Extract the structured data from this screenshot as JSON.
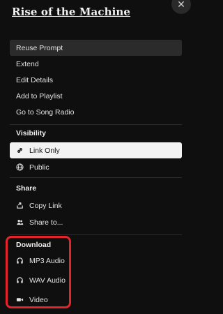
{
  "title": "Rise of the Machine",
  "close_icon": "close-icon",
  "actions": [
    {
      "label": "Reuse Prompt"
    },
    {
      "label": "Extend"
    },
    {
      "label": "Edit Details"
    },
    {
      "label": "Add to Playlist"
    },
    {
      "label": "Go to Song Radio"
    }
  ],
  "visibility": {
    "title": "Visibility",
    "options": [
      {
        "label": "Link Only",
        "icon": "link-icon",
        "selected": true
      },
      {
        "label": "Public",
        "icon": "globe-icon",
        "selected": false
      }
    ]
  },
  "share": {
    "title": "Share",
    "items": [
      {
        "label": "Copy Link",
        "icon": "share-icon"
      },
      {
        "label": "Share to...",
        "icon": "people-icon"
      }
    ]
  },
  "download": {
    "title": "Download",
    "items": [
      {
        "label": "MP3 Audio",
        "icon": "headphones-icon"
      },
      {
        "label": "WAV Audio",
        "icon": "headphones-icon"
      },
      {
        "label": "Video",
        "icon": "video-camera-icon"
      }
    ]
  },
  "colors": {
    "background": "#0f0f0f",
    "selected": "#f2f2f2",
    "highlight_box": "#e3242b"
  }
}
